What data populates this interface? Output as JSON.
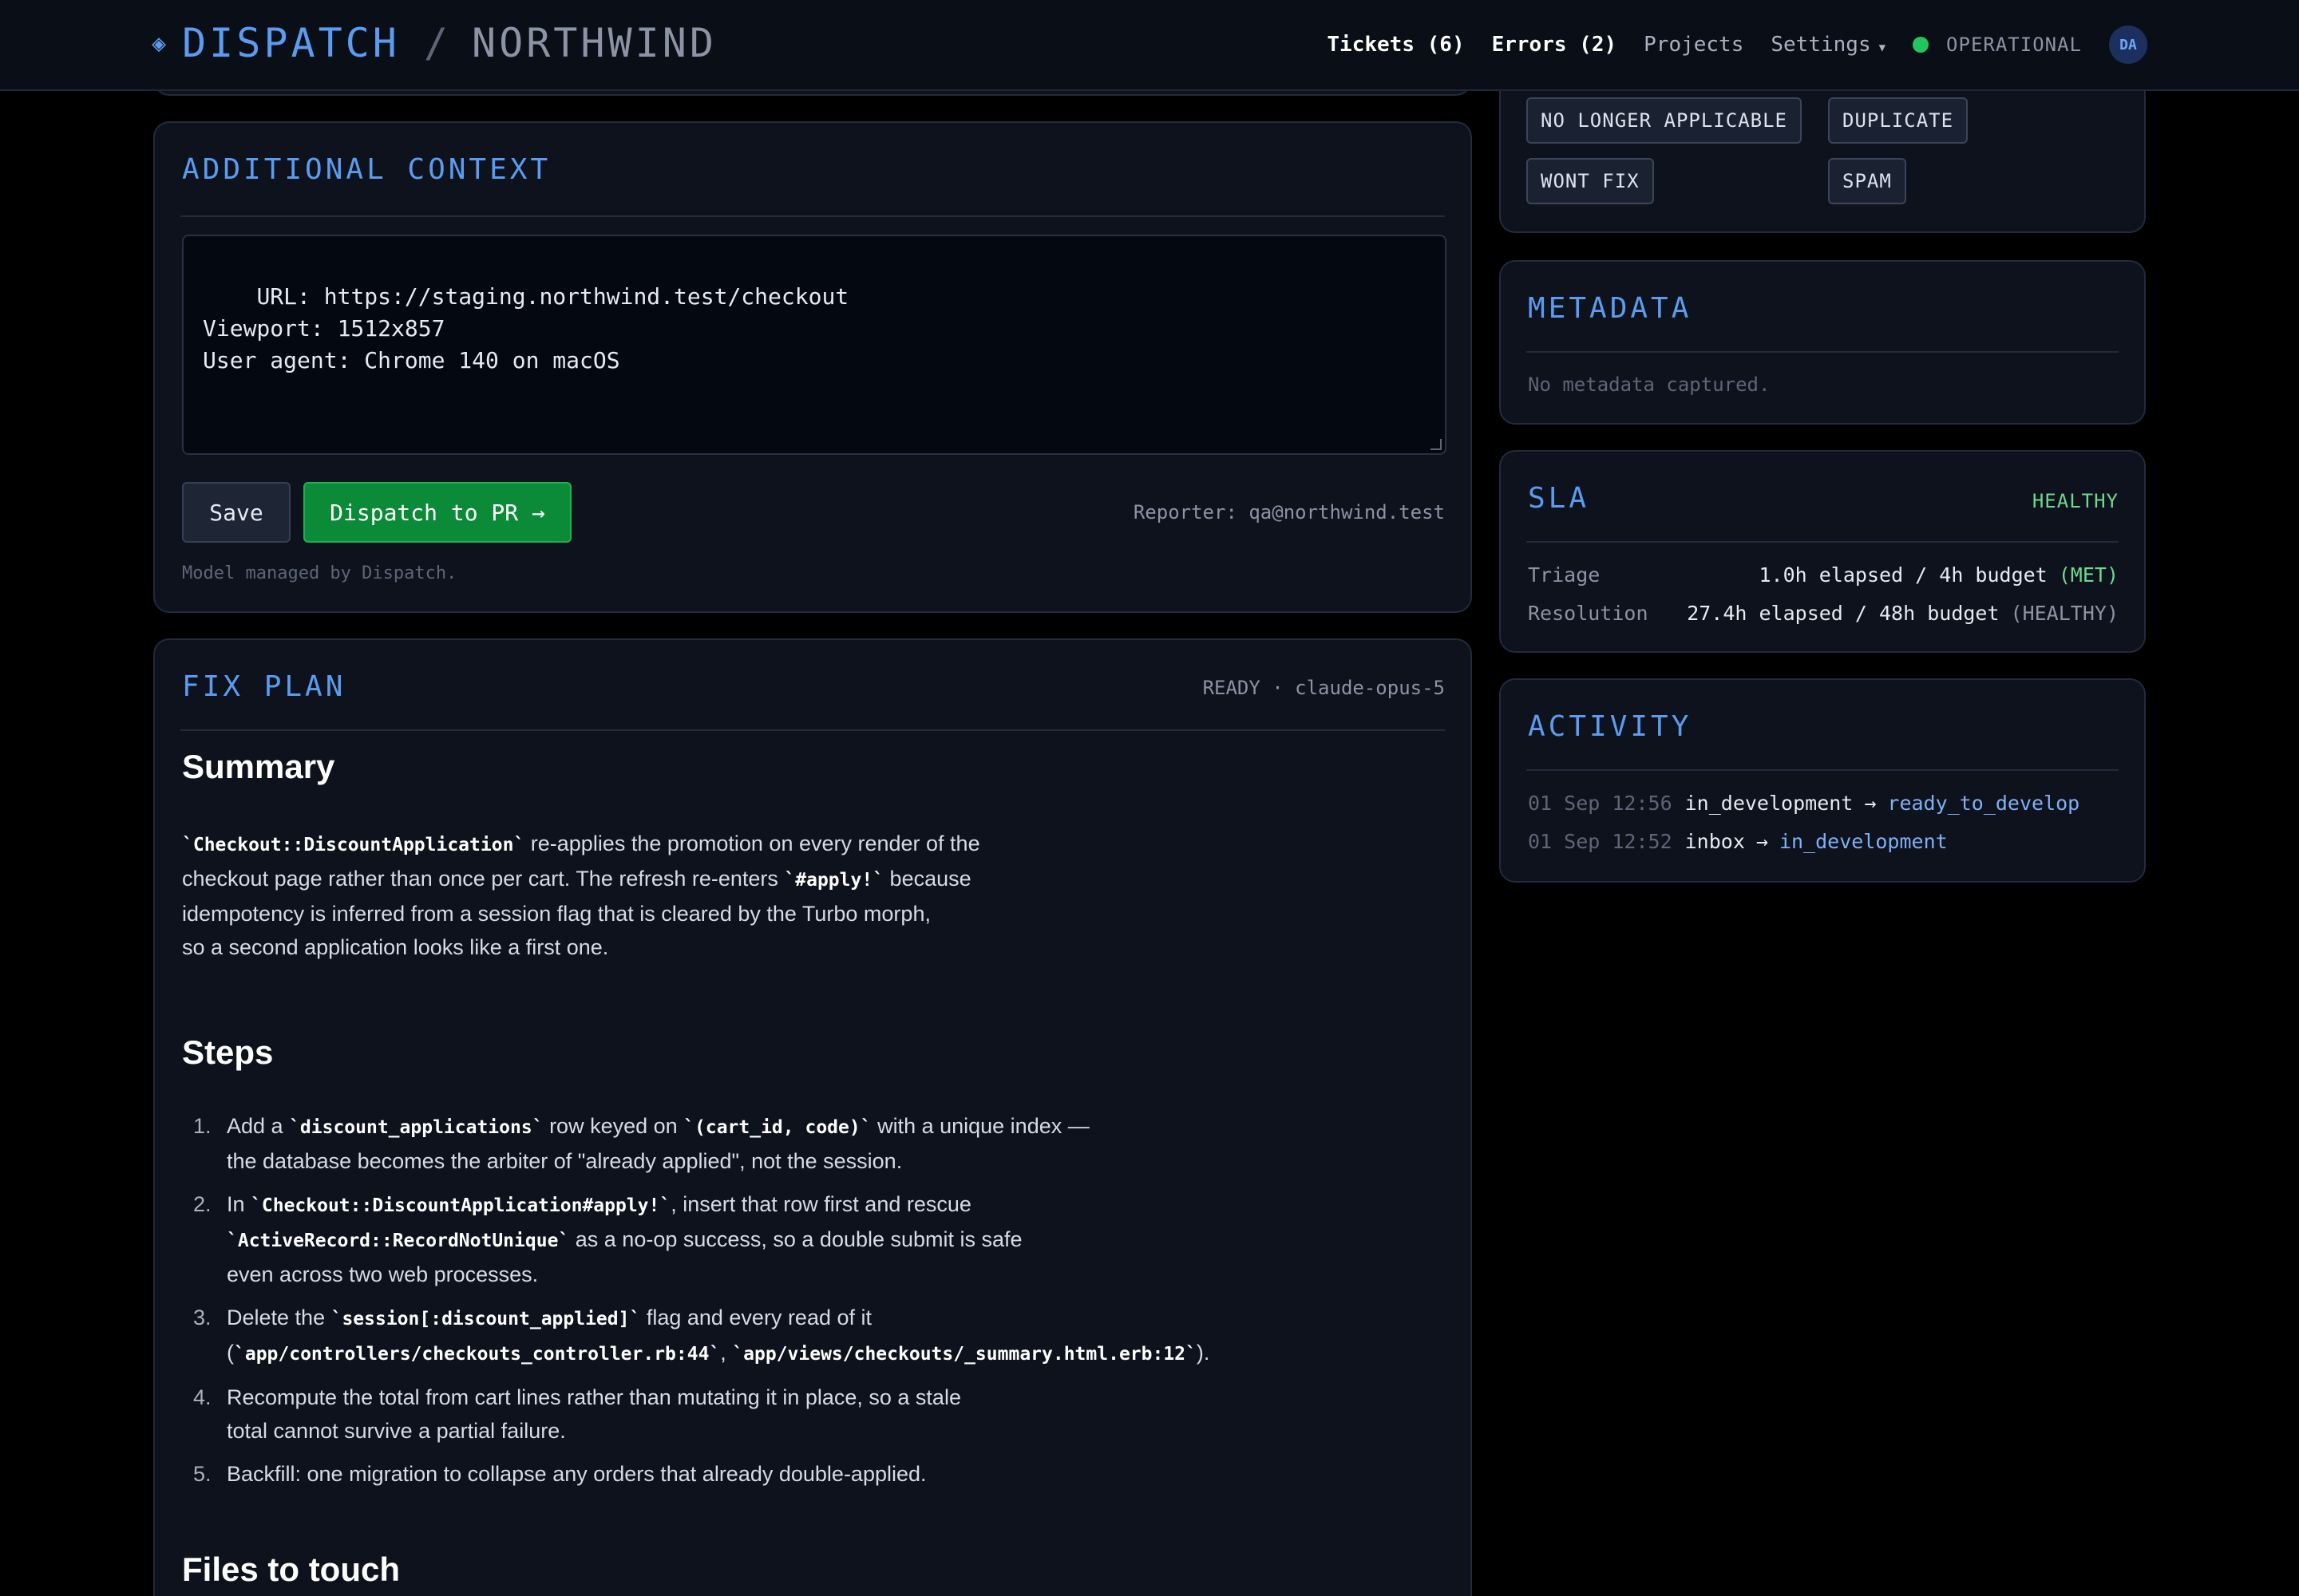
{
  "header": {
    "brand_icon": "◈",
    "brand": "DISPATCH",
    "separator": "/",
    "project": "NORTHWIND",
    "nav": {
      "tickets": "Tickets (6)",
      "errors": "Errors (2)",
      "projects": "Projects",
      "settings": "Settings",
      "status": "OPERATIONAL",
      "avatar": "DA"
    }
  },
  "close_reasons": {
    "no_longer_applicable": "NO LONGER APPLICABLE",
    "duplicate": "DUPLICATE",
    "wont_fix": "WONT FIX",
    "spam": "SPAM"
  },
  "context": {
    "title": "ADDITIONAL CONTEXT",
    "text": "URL: https://staging.northwind.test/checkout\nViewport: 1512x857\nUser agent: Chrome 140 on macOS",
    "save_label": "Save",
    "dispatch_label": "Dispatch to PR →",
    "reporter": "Reporter: qa@northwind.test",
    "model_note": "Model managed by Dispatch."
  },
  "plan": {
    "title": "FIX PLAN",
    "meta": "READY · claude-opus-5",
    "summary_heading": "Summary",
    "summary": {
      "code1": "`Checkout::DiscountApplication`",
      "t1": " re-applies the promotion on every render of the",
      "t2": "checkout page rather than once per cart. The refresh re-enters ",
      "code2": "`#apply!`",
      "t3": " because",
      "t4": "idempotency is inferred from a session flag that is cleared by the Turbo morph,",
      "t5": "so a second application looks like a first one."
    },
    "steps_heading": "Steps",
    "steps": [
      {
        "num": "1.",
        "a": "Add a ",
        "c1": "`discount_applications`",
        "b": " row keyed on ",
        "c2": "`(cart_id, code)`",
        "c": " with a unique index —",
        "d": "the database becomes the arbiter of \"already applied\", not the session."
      },
      {
        "num": "2.",
        "a": "In ",
        "c1": "`Checkout::DiscountApplication#apply!`",
        "b": ", insert that row first and rescue",
        "c2": "`ActiveRecord::RecordNotUnique`",
        "c": " as a no-op success, so a double submit is safe",
        "d": "even across two web processes."
      },
      {
        "num": "3.",
        "a": "Delete the ",
        "c1": "`session[:discount_applied]`",
        "b": " flag and every read of it",
        "open": "(",
        "c2": "`app/controllers/checkouts_controller.rb:44`",
        "comma": ", ",
        "c3": "`app/views/checkouts/_summary.html.erb:12`",
        "close": ")."
      },
      {
        "num": "4.",
        "a": "Recompute the total from cart lines rather than mutating it in place, so a stale",
        "d": "total cannot survive a partial failure."
      },
      {
        "num": "5.",
        "a": "Backfill: one migration to collapse any orders that already double-applied."
      }
    ],
    "files_heading": "Files to touch"
  },
  "metadata": {
    "title": "METADATA",
    "empty": "No metadata captured."
  },
  "sla": {
    "title": "SLA",
    "state": "HEALTHY",
    "rows": [
      {
        "label": "Triage",
        "value": "1.0h elapsed / 4h budget",
        "tag": "(MET)"
      },
      {
        "label": "Resolution",
        "value": "27.4h elapsed / 48h budget",
        "tag": "(HEALTHY)"
      }
    ]
  },
  "activity": {
    "title": "ACTIVITY",
    "items": [
      {
        "time": "01 Sep 12:56",
        "from": "in_development",
        "arrow": "→",
        "to": "ready_to_develop"
      },
      {
        "time": "01 Sep 12:52",
        "from": "inbox",
        "arrow": "→",
        "to": "in_development"
      }
    ]
  },
  "colors": {
    "accent": "#5b9cf0",
    "background": "#000000",
    "card": "#0e121c",
    "success": "#22c55e",
    "dispatch_button": "#0b8a37"
  }
}
